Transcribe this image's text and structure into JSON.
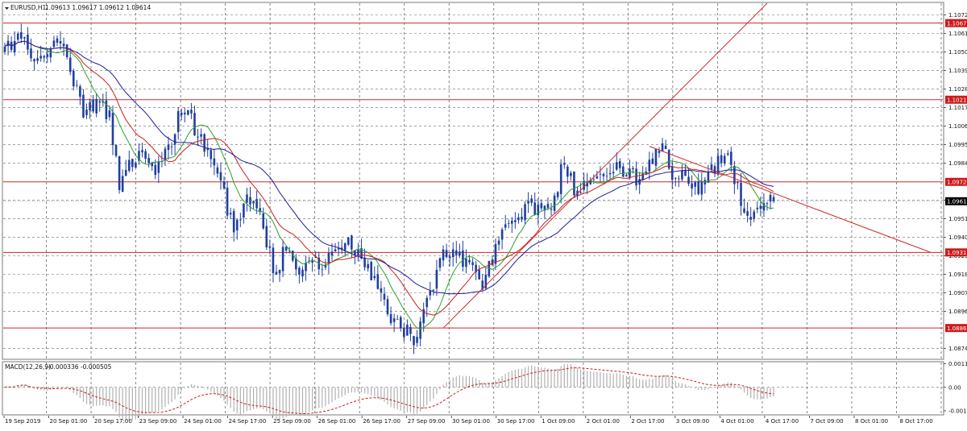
{
  "chart_header": {
    "symbol_label": "EURUSD,H1",
    "ohlc_text": "1.09613 1.09617 1.09612 1.09614"
  },
  "macd_header": {
    "label": "MACD(12,26,9)",
    "values_text": "-0.000336 -0.000505"
  },
  "colors": {
    "background": "#ffffff",
    "grid": "#6a6a6a",
    "candles": "#1f3fa0",
    "ma_fast": "#2ea02e",
    "ma_mid": "#c8201e",
    "ma_slow": "#1e1e9c",
    "levels": "#cc2a2a",
    "price_label_bg": "#cc1a1a",
    "current_label_bg": "#000000",
    "macd_hist": "#b0b0b0",
    "macd_signal": "#c8201e"
  },
  "chart_data": [
    {
      "type": "candlestick",
      "title": "EURUSD,H1",
      "ylim": [
        1.0868,
        1.1079
      ],
      "price_axis_ticks": [
        "1.10720",
        "1.10610",
        "1.10500",
        "1.10390",
        "1.10280",
        "1.10170",
        "1.10060",
        "1.09950",
        "1.09840",
        "1.09620",
        "1.09510",
        "1.09400",
        "1.09290",
        "1.09180",
        "1.09070",
        "1.08960",
        "1.08740"
      ],
      "time_axis_labels": [
        "19 Sep 2019",
        "20 Sep 01:00",
        "20 Sep 17:00",
        "23 Sep 09:00",
        "24 Sep 01:00",
        "24 Sep 17:00",
        "25 Sep 09:00",
        "26 Sep 01:00",
        "26 Sep 17:00",
        "27 Sep 09:00",
        "30 Sep 01:00",
        "30 Sep 17:00",
        "1 Oct 09:00",
        "2 Oct 01:00",
        "2 Oct 17:00",
        "3 Oct 09:00",
        "4 Oct 01:00",
        "4 Oct 17:00",
        "7 Oct 09:00",
        "8 Oct 01:00",
        "8 Oct 17:00"
      ],
      "horizontal_levels": [
        {
          "value": 1.10672,
          "label": "1.10672"
        },
        {
          "value": 1.10217,
          "label": "1.10217"
        },
        {
          "value": 1.09729,
          "label": "1.09729"
        },
        {
          "value": 1.0931,
          "label": "1.09310"
        },
        {
          "value": 1.08861,
          "label": "1.08861"
        }
      ],
      "current_price": {
        "value": 1.09614,
        "label": "1.09614"
      },
      "close_path_anchors": [
        [
          0,
          1.105
        ],
        [
          4,
          1.1063
        ],
        [
          8,
          1.1051
        ],
        [
          12,
          1.1046
        ],
        [
          16,
          1.1058
        ],
        [
          20,
          1.1042
        ],
        [
          24,
          1.1013
        ],
        [
          28,
          1.102
        ],
        [
          32,
          1.101
        ],
        [
          35,
          1.097
        ],
        [
          38,
          1.0983
        ],
        [
          42,
          1.0989
        ],
        [
          46,
          1.0982
        ],
        [
          50,
          1.0993
        ],
        [
          54,
          1.1015
        ],
        [
          58,
          1.1006
        ],
        [
          62,
          1.0992
        ],
        [
          66,
          1.0973
        ],
        [
          70,
          1.0942
        ],
        [
          74,
          1.096
        ],
        [
          78,
          1.0958
        ],
        [
          82,
          1.092
        ],
        [
          86,
          1.0932
        ],
        [
          90,
          1.0918
        ],
        [
          94,
          1.0926
        ],
        [
          98,
          1.0925
        ],
        [
          102,
          1.0935
        ],
        [
          106,
          1.0936
        ],
        [
          110,
          1.0926
        ],
        [
          114,
          1.0912
        ],
        [
          118,
          1.089
        ],
        [
          122,
          1.0884
        ],
        [
          125,
          1.088
        ],
        [
          128,
          1.0893
        ],
        [
          131,
          1.091
        ],
        [
          134,
          1.0931
        ],
        [
          138,
          1.0932
        ],
        [
          142,
          1.0923
        ],
        [
          146,
          1.0906
        ],
        [
          149,
          1.0928
        ],
        [
          152,
          1.0945
        ],
        [
          156,
          1.0955
        ],
        [
          160,
          1.0957
        ],
        [
          164,
          1.0954
        ],
        [
          168,
          1.0963
        ],
        [
          171,
          1.0988
        ],
        [
          174,
          1.0968
        ],
        [
          178,
          1.0975
        ],
        [
          182,
          1.0977
        ],
        [
          186,
          1.098
        ],
        [
          190,
          1.098
        ],
        [
          194,
          1.0972
        ],
        [
          198,
          1.0984
        ],
        [
          201,
          1.0995
        ],
        [
          204,
          1.0976
        ],
        [
          208,
          1.0975
        ],
        [
          212,
          1.097
        ],
        [
          216,
          1.0979
        ],
        [
          220,
          1.0989
        ],
        [
          223,
          1.0977
        ],
        [
          226,
          1.095
        ],
        [
          229,
          1.0953
        ],
        [
          232,
          1.096
        ],
        [
          235,
          1.0961
        ]
      ],
      "moving_averages": [
        {
          "name": "MA fast",
          "period": 10
        },
        {
          "name": "MA mid",
          "period": 18
        },
        {
          "name": "MA slow",
          "period": 30
        }
      ],
      "trendlines": [
        {
          "from": [
            134,
            1.08861
          ],
          "to": [
            233,
            1.1079
          ]
        },
        {
          "from": [
            197,
            1.0994
          ],
          "to": [
            283,
            1.0931
          ]
        }
      ]
    },
    {
      "type": "macd",
      "title": "MACD(12,26,9)",
      "ylim": [
        -0.00135,
        0.00125
      ],
      "price_axis_ticks": [
        "0.001195",
        "0.00",
        "-0.001184"
      ]
    }
  ]
}
